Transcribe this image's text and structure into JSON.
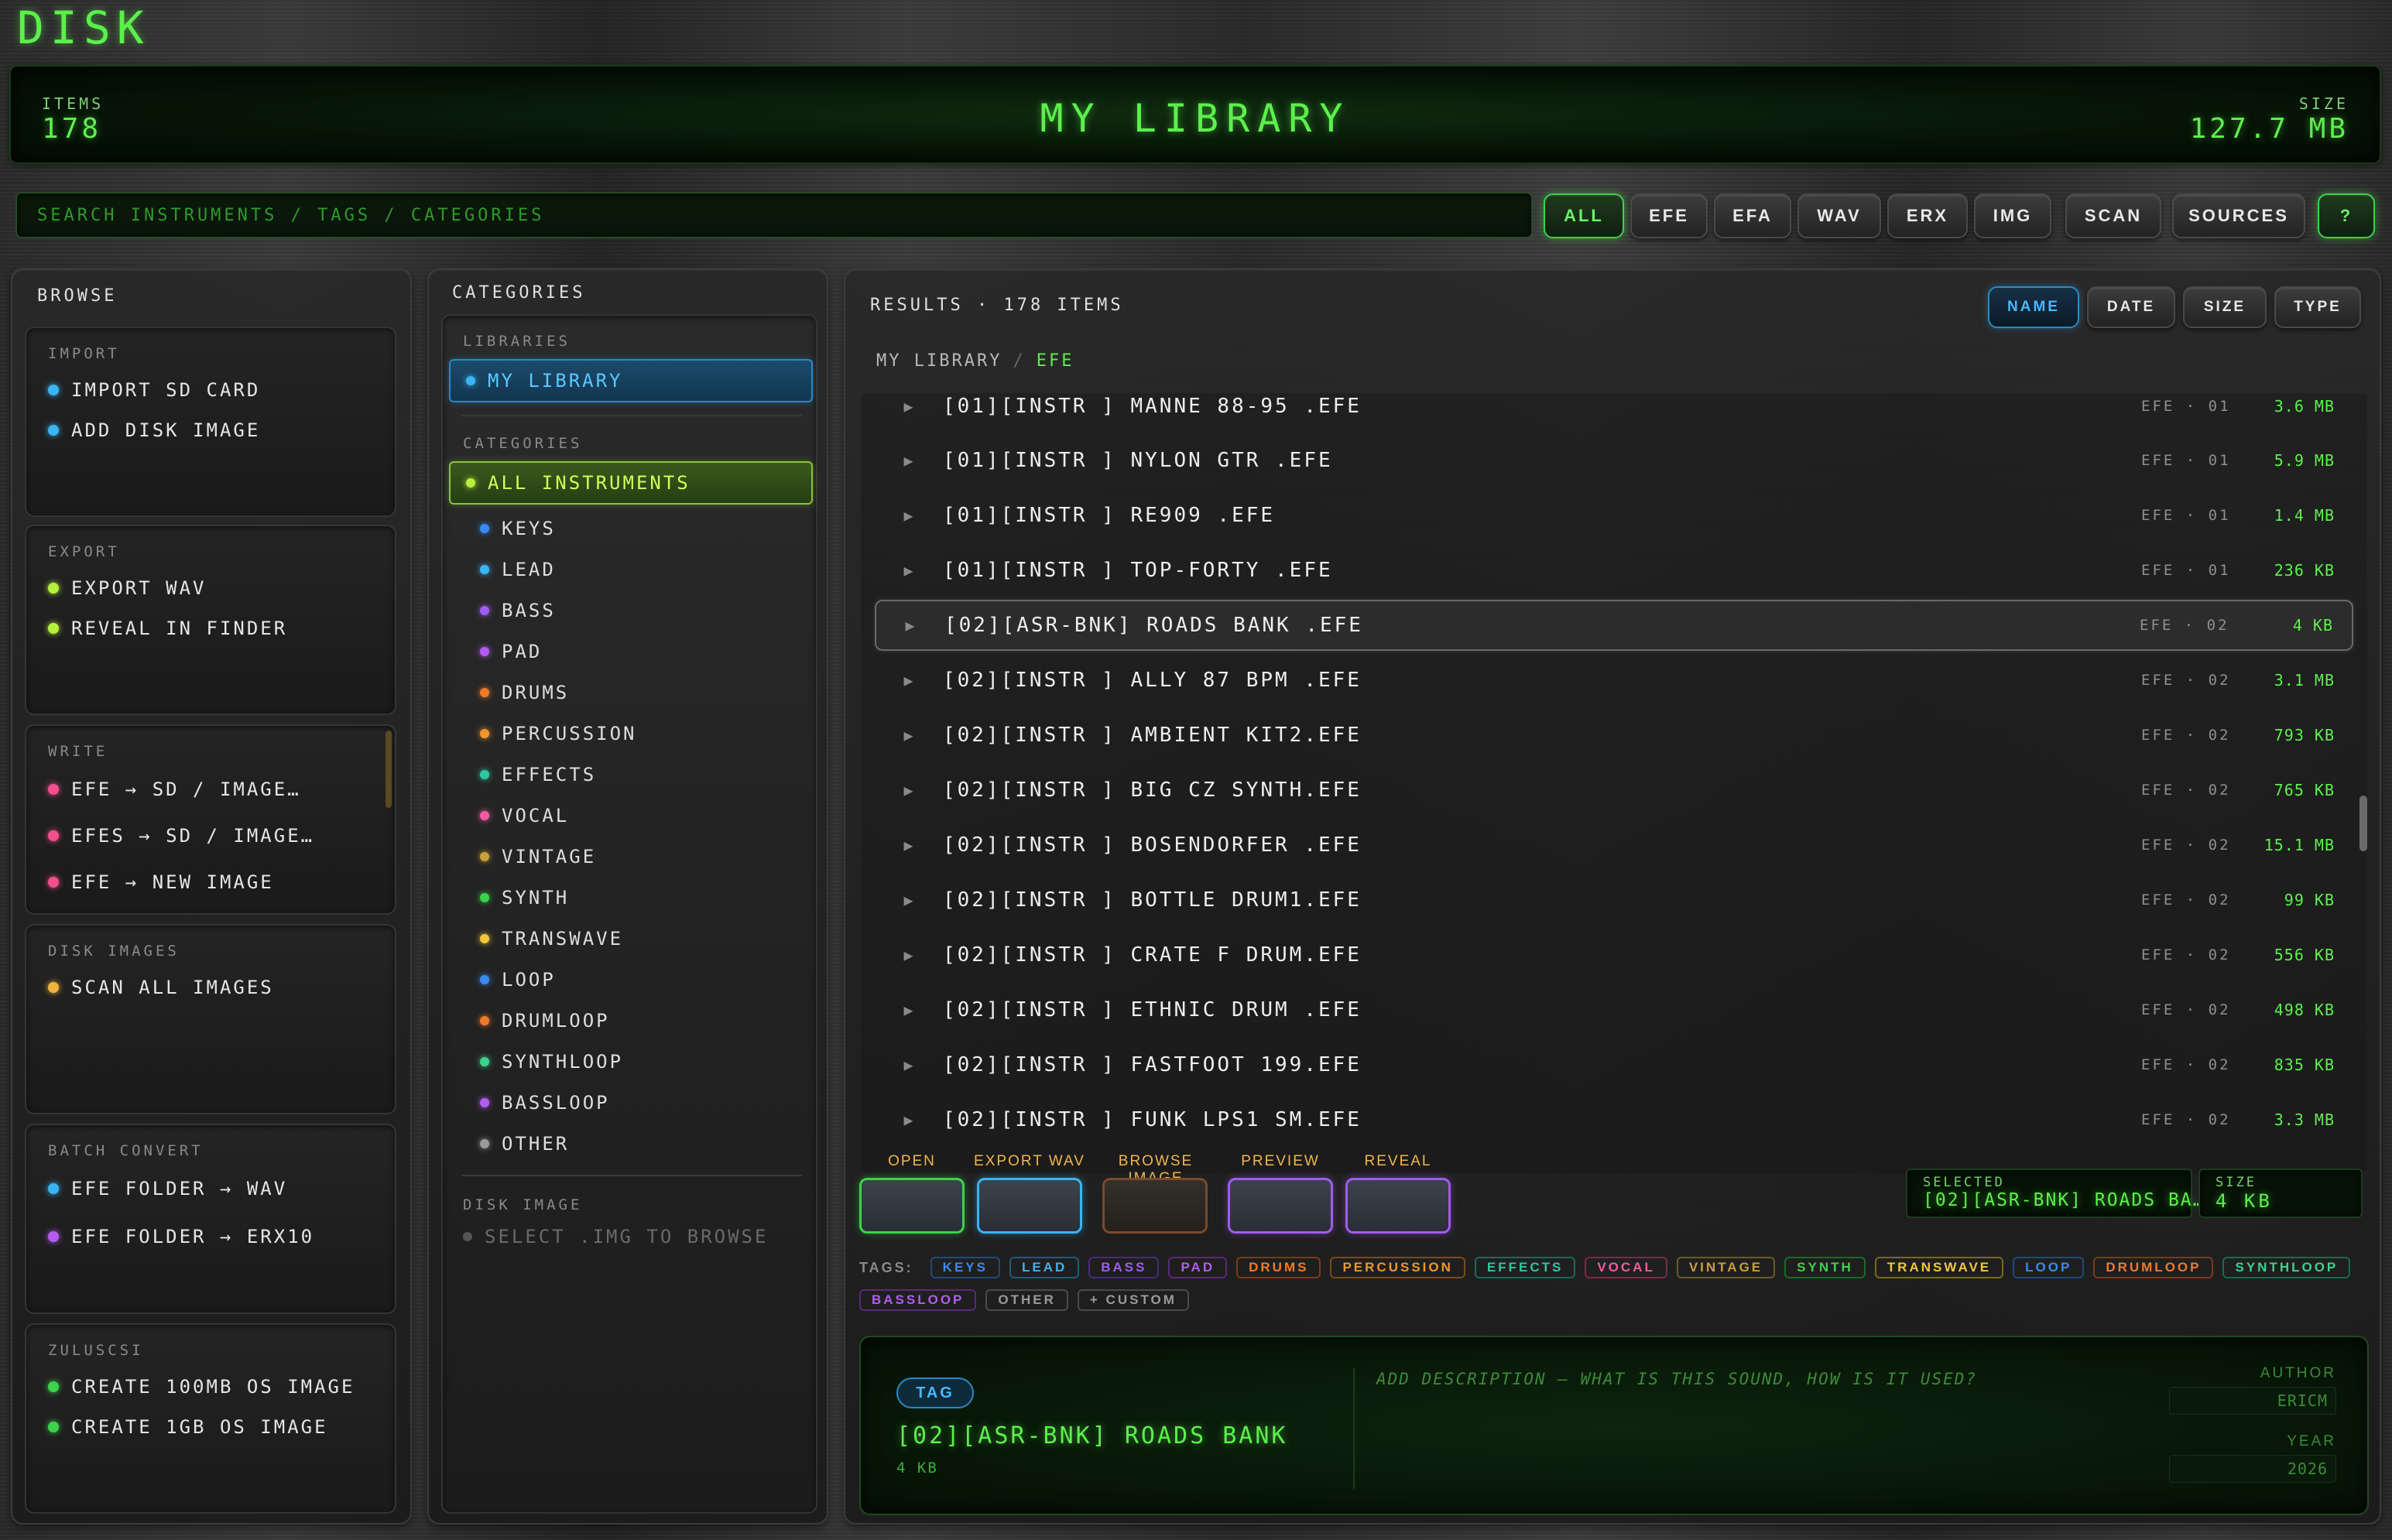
{
  "app": {
    "title": "DISK"
  },
  "header": {
    "items_label": "ITEMS",
    "items_value": "178",
    "library_title": "MY LIBRARY",
    "size_label": "SIZE",
    "size_value": "127.7 MB"
  },
  "search": {
    "placeholder": "SEARCH INSTRUMENTS / TAGS / CATEGORIES"
  },
  "filters": [
    "ALL",
    "EFE",
    "EFA",
    "WAV",
    "ERX",
    "IMG",
    "SCAN",
    "SOURCES",
    "?"
  ],
  "browse": {
    "title": "BROWSE",
    "groups": [
      {
        "title": "IMPORT",
        "items": [
          {
            "label": "IMPORT SD CARD",
            "color": "#3ab4f2"
          },
          {
            "label": "ADD DISK IMAGE",
            "color": "#3ab4f2"
          }
        ]
      },
      {
        "title": "EXPORT",
        "items": [
          {
            "label": "EXPORT WAV",
            "color": "#b6f03c"
          },
          {
            "label": "REVEAL IN FINDER",
            "color": "#b6f03c"
          }
        ]
      },
      {
        "title": "WRITE",
        "items": [
          {
            "label": "EFE → SD / IMAGE…",
            "color": "#f0508c"
          },
          {
            "label": "EFES → SD / IMAGE…",
            "color": "#f0508c"
          },
          {
            "label": "EFE → NEW IMAGE",
            "color": "#f0508c"
          }
        ]
      },
      {
        "title": "DISK IMAGES",
        "items": [
          {
            "label": "SCAN ALL IMAGES",
            "color": "#f0b43c"
          }
        ]
      },
      {
        "title": "BATCH CONVERT",
        "items": [
          {
            "label": "EFE FOLDER → WAV",
            "color": "#3ab4f2"
          },
          {
            "label": "EFE FOLDER → ERX10",
            "color": "#b45cf0"
          }
        ]
      },
      {
        "title": "ZULUSCSI",
        "items": [
          {
            "label": "CREATE 100MB OS IMAGE",
            "color": "#3cd24a"
          },
          {
            "label": "CREATE 1GB OS IMAGE",
            "color": "#3cd24a"
          }
        ]
      }
    ]
  },
  "categories_panel": {
    "title": "CATEGORIES",
    "libraries_label": "LIBRARIES",
    "library_item": "MY LIBRARY",
    "categories_label": "CATEGORIES",
    "all_instruments": "ALL INSTRUMENTS",
    "items": [
      {
        "label": "KEYS",
        "color": "#3a8af2"
      },
      {
        "label": "LEAD",
        "color": "#3ab4f2"
      },
      {
        "label": "BASS",
        "color": "#a05cf0"
      },
      {
        "label": "PAD",
        "color": "#b45cf0"
      },
      {
        "label": "DRUMS",
        "color": "#f07a2c"
      },
      {
        "label": "PERCUSSION",
        "color": "#f0962c"
      },
      {
        "label": "EFFECTS",
        "color": "#2cc8a0"
      },
      {
        "label": "VOCAL",
        "color": "#f05ca0"
      },
      {
        "label": "VINTAGE",
        "color": "#c8a03c"
      },
      {
        "label": "SYNTH",
        "color": "#3cd24a"
      },
      {
        "label": "TRANSWAVE",
        "color": "#f0c83c"
      },
      {
        "label": "LOOP",
        "color": "#3a8af2"
      },
      {
        "label": "DRUMLOOP",
        "color": "#f07a2c"
      },
      {
        "label": "SYNTHLOOP",
        "color": "#3cd28c"
      },
      {
        "label": "BASSLOOP",
        "color": "#b45cf0"
      },
      {
        "label": "OTHER",
        "color": "#9a9a9a"
      }
    ],
    "disk_image_label": "DISK IMAGE",
    "disk_image_hint": "SELECT .IMG TO BROWSE"
  },
  "results": {
    "title": "RESULTS · 178 ITEMS",
    "sort": [
      "NAME",
      "DATE",
      "SIZE",
      "TYPE"
    ],
    "breadcrumb_root": "MY LIBRARY",
    "breadcrumb_sep": "/",
    "breadcrumb_leaf": "EFE",
    "rows": [
      {
        "name": "[01][INSTR ] MANNE 88-95 .EFE",
        "meta": "EFE · 01",
        "size": "3.6 MB"
      },
      {
        "name": "[01][INSTR ] NYLON GTR .EFE",
        "meta": "EFE · 01",
        "size": "5.9 MB"
      },
      {
        "name": "[01][INSTR ] RE909 .EFE",
        "meta": "EFE · 01",
        "size": "1.4 MB"
      },
      {
        "name": "[01][INSTR ] TOP-FORTY .EFE",
        "meta": "EFE · 01",
        "size": "236 KB"
      },
      {
        "name": "[02][ASR-BNK] ROADS BANK .EFE",
        "meta": "EFE · 02",
        "size": "4 KB"
      },
      {
        "name": "[02][INSTR ] ALLY 87 BPM .EFE",
        "meta": "EFE · 02",
        "size": "3.1 MB"
      },
      {
        "name": "[02][INSTR ] AMBIENT KIT2.EFE",
        "meta": "EFE · 02",
        "size": "793 KB"
      },
      {
        "name": "[02][INSTR ] BIG CZ SYNTH.EFE",
        "meta": "EFE · 02",
        "size": "765 KB"
      },
      {
        "name": "[02][INSTR ] BOSENDORFER .EFE",
        "meta": "EFE · 02",
        "size": "15.1 MB"
      },
      {
        "name": "[02][INSTR ] BOTTLE DRUM1.EFE",
        "meta": "EFE · 02",
        "size": "99 KB"
      },
      {
        "name": "[02][INSTR ] CRATE F DRUM.EFE",
        "meta": "EFE · 02",
        "size": "556 KB"
      },
      {
        "name": "[02][INSTR ] ETHNIC DRUM .EFE",
        "meta": "EFE · 02",
        "size": "498 KB"
      },
      {
        "name": "[02][INSTR ] FASTFOOT 199.EFE",
        "meta": "EFE · 02",
        "size": "835 KB"
      },
      {
        "name": "[02][INSTR ] FUNK LPS1 SM.EFE",
        "meta": "EFE · 02",
        "size": "3.3 MB"
      }
    ]
  },
  "actions": [
    {
      "label": "OPEN",
      "color": "#3cd24a"
    },
    {
      "label": "EXPORT WAV",
      "color": "#3ab4f2"
    },
    {
      "label": "BROWSE IMAGE",
      "color": "#f07a2c"
    },
    {
      "label": "PREVIEW",
      "color": "#a05cf0"
    },
    {
      "label": "REVEAL",
      "color": "#a05cf0"
    }
  ],
  "selected": {
    "label": "SELECTED",
    "value": "[02][ASR-BNK] ROADS BA…",
    "size_label": "SIZE",
    "size_value": "4 KB"
  },
  "tags": {
    "label": "TAGS:",
    "items": [
      {
        "label": "KEYS",
        "color": "#3a8af2"
      },
      {
        "label": "LEAD",
        "color": "#3ab4f2"
      },
      {
        "label": "BASS",
        "color": "#a05cf0"
      },
      {
        "label": "PAD",
        "color": "#b45cf0"
      },
      {
        "label": "DRUMS",
        "color": "#f07a2c"
      },
      {
        "label": "PERCUSSION",
        "color": "#f0962c"
      },
      {
        "label": "EFFECTS",
        "color": "#2cc8a0"
      },
      {
        "label": "VOCAL",
        "color": "#f05ca0"
      },
      {
        "label": "VINTAGE",
        "color": "#c8a03c"
      },
      {
        "label": "SYNTH",
        "color": "#3cd24a"
      },
      {
        "label": "TRANSWAVE",
        "color": "#f0c83c"
      },
      {
        "label": "LOOP",
        "color": "#3a8af2"
      },
      {
        "label": "DRUMLOOP",
        "color": "#f07a2c"
      },
      {
        "label": "SYNTHLOOP",
        "color": "#3cd28c"
      },
      {
        "label": "BASSLOOP",
        "color": "#b45cf0"
      },
      {
        "label": "OTHER",
        "color": "#9a9a9a"
      },
      {
        "label": "+ CUSTOM",
        "color": "#9a9a9a"
      }
    ]
  },
  "detail": {
    "tag_badge": "TAG",
    "name": "[02][ASR-BNK] ROADS BANK",
    "size": "4 KB",
    "description_placeholder": "ADD DESCRIPTION — WHAT IS THIS SOUND, HOW IS IT USED?",
    "author_label": "AUTHOR",
    "author_value": "ERICM",
    "year_label": "YEAR",
    "year_value": "2026"
  }
}
